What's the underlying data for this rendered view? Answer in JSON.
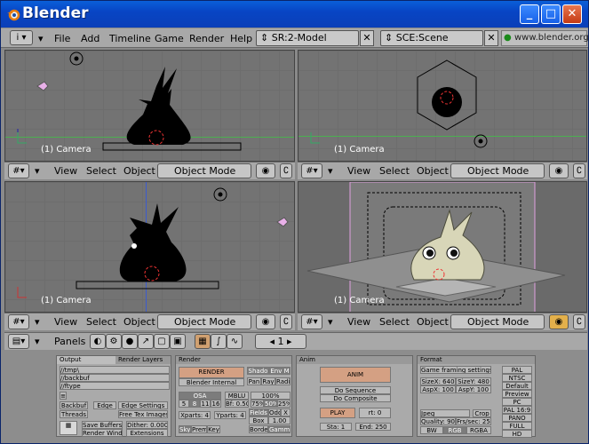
{
  "app": {
    "title": "Blender"
  },
  "window_buttons": {
    "minimize": "_",
    "maximize": "□",
    "close": "✕"
  },
  "menu": {
    "items": [
      "File",
      "Add",
      "Timeline",
      "Game",
      "Render",
      "Help"
    ],
    "screen": "SR:2-Model",
    "scene": "SCE:Scene",
    "url": "www.blender.org"
  },
  "viewports": [
    {
      "label": "(1) Camera"
    },
    {
      "label": "(1) Camera"
    },
    {
      "label": "(1) Camera"
    },
    {
      "label": "(1) Camera"
    }
  ],
  "vp_header": {
    "view": "View",
    "select": "Select",
    "object": "Object",
    "mode": "Object Mode"
  },
  "buttons_header": {
    "panels": "Panels",
    "frame": "1"
  },
  "panel_titles": {
    "output": "Output",
    "render_layers": "Render Layers",
    "render": "Render",
    "anim": "Anim",
    "format": "Format"
  },
  "output": {
    "paths": [
      "//tmp\\",
      "//backbuf",
      "//ftype"
    ],
    "backbuf": "Backbuf",
    "edge": "Edge",
    "edge_settings": "Edge Settings",
    "threads": "Threads",
    "free_tex": "Free Tex Images",
    "save_buffers": "Save Buffers",
    "render_wind": "Render Wind",
    "dither": "Dither: 0.000",
    "extensions": "Extensions"
  },
  "render": {
    "render_btn": "RENDER",
    "engine": "Blender Internal",
    "shadow": "Shado",
    "envmap": "Env M",
    "pan": "Pan",
    "ray": "Ray",
    "radio": "Radi",
    "osa": "OSA",
    "mblur": "MBLU",
    "pct100": "100%",
    "osa_vals": [
      "5",
      "8",
      "11",
      "16"
    ],
    "blur": "Bf: 0.50",
    "pcts": [
      "75%",
      "50%",
      "25%"
    ],
    "xparts": "Xparts: 4",
    "yparts": "Yparts: 4",
    "fields": "Fields",
    "odd": "Odd",
    "x": "X",
    "box": "Box",
    "filt": "1.00",
    "sky": "Sky",
    "premul": "Prem",
    "key": "Key",
    "border": "Border",
    "gamma": "Gamma"
  },
  "anim": {
    "anim_btn": "ANIM",
    "do_sequence": "Do Sequence",
    "do_composite": "Do Composite",
    "play": "PLAY",
    "rt": "rt: 0",
    "sta": "Sta: 1",
    "end": "End: 250"
  },
  "format": {
    "game_framing": "Game framing settings",
    "sizex": "SizeX: 640",
    "sizey": "SizeY: 480",
    "aspx": "AspX: 100",
    "aspy": "AspY: 100",
    "presets": [
      "PAL",
      "NTSC",
      "Default",
      "Preview",
      "PC",
      "PAL 16:9",
      "PANO",
      "FULL",
      "HD"
    ],
    "codec": "Jpeg",
    "crop": "Crop",
    "quality": "Quality: 90",
    "fps": "Frs/sec: 25",
    "bw": "BW",
    "rgb": "RGB",
    "rgba": "RGBA"
  }
}
